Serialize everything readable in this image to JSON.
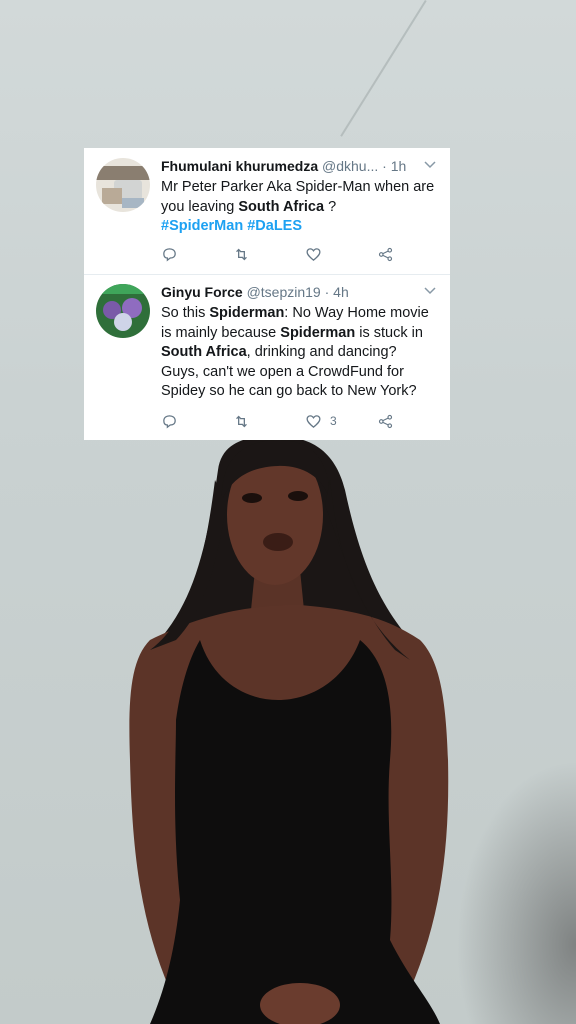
{
  "tweets": [
    {
      "display_name": "Fhumulani khurumedza",
      "handle": "@dkhu...",
      "time": "· 1h",
      "text_parts": {
        "p1": "Mr Peter Parker Aka Spider-Man when are you leaving ",
        "b1": "South Africa",
        "p2": " ?"
      },
      "hashtags": [
        "#SpiderMan",
        "#DaLES"
      ],
      "likes": ""
    },
    {
      "display_name": "Ginyu Force",
      "handle": "@tsepzin19",
      "time": "· 4h",
      "text_parts": {
        "p1": "So this ",
        "b1": "Spiderman",
        "p2": ": No Way Home movie is mainly because ",
        "b2": "Spiderman",
        "p3": " is stuck in ",
        "b3": "South Africa",
        "p4": ", drinking and dancing? Guys, can't we open a CrowdFund for Spidey so he can go back to New York?"
      },
      "likes": "3"
    }
  ],
  "icons": {
    "reply": "reply-icon",
    "retweet": "retweet-icon",
    "like": "heart-icon",
    "share": "share-icon",
    "menu": "chevron-down-icon"
  },
  "colors": {
    "link": "#1da1f2",
    "muted": "#657786",
    "text": "#14171a",
    "card": "#ffffff"
  }
}
